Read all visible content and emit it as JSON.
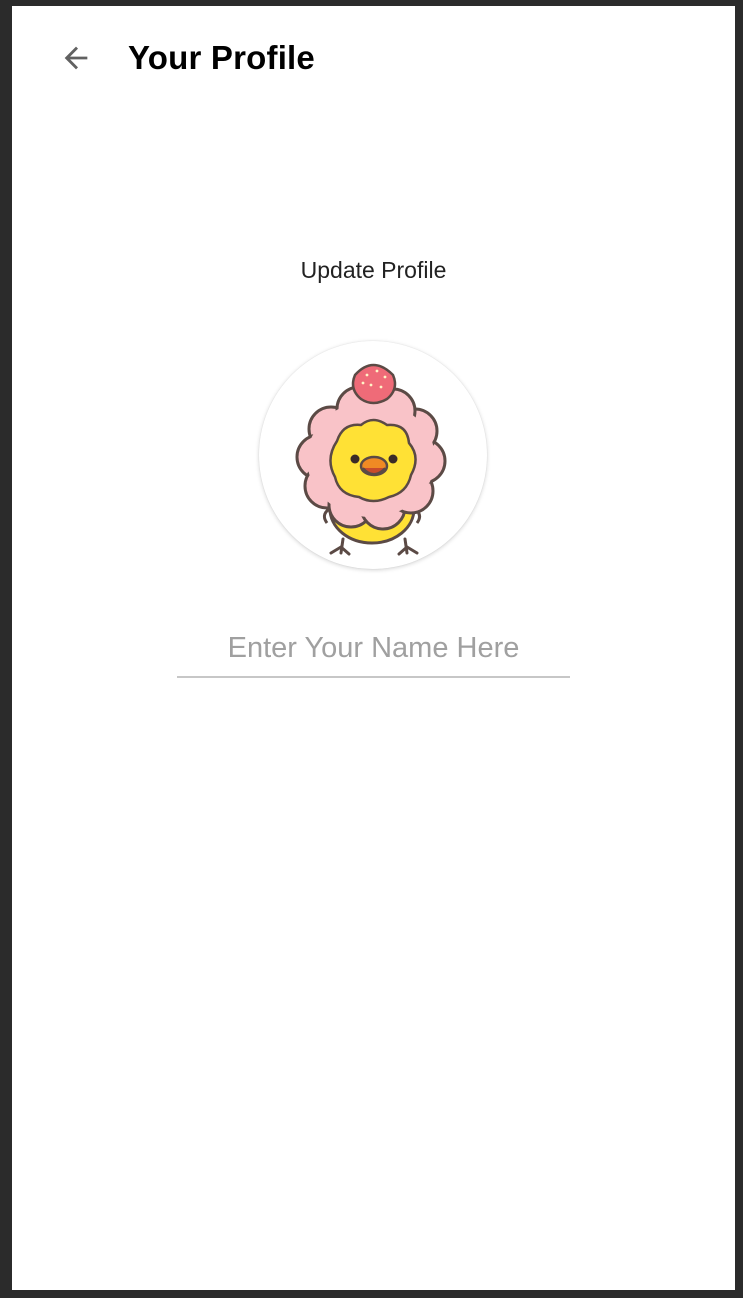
{
  "header": {
    "title": "Your Profile",
    "back_icon": "arrow-left-icon"
  },
  "profile": {
    "heading": "Update Profile",
    "avatar_icon": "chick-strawberry-avatar",
    "name_input": {
      "value": "",
      "placeholder": "Enter Your Name Here"
    }
  },
  "colors": {
    "background": "#ffffff",
    "frame": "#2b2b2b",
    "title_text": "#000000",
    "placeholder": "#a0a0a0",
    "underline": "#c7c7c7",
    "back_arrow": "#616161",
    "avatar_pink": "#f9c3c8",
    "avatar_yellow": "#ffe135",
    "strawberry_red": "#ef6b78"
  }
}
